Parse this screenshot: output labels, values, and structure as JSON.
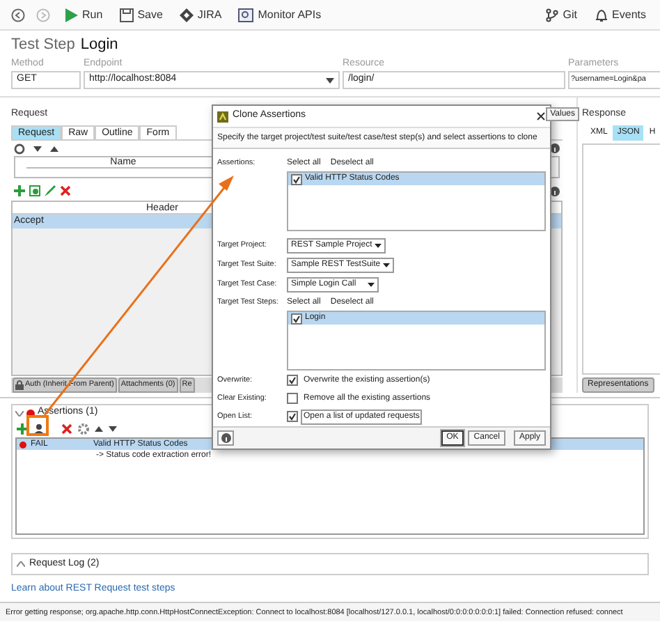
{
  "toolbar": {
    "items": [
      {
        "kind": "back"
      },
      {
        "kind": "forward"
      },
      {
        "kind": "run",
        "label": "Run"
      },
      {
        "kind": "save",
        "label": "Save"
      },
      {
        "kind": "jira",
        "label": "JIRA"
      },
      {
        "kind": "monitor",
        "label": "Monitor APIs"
      }
    ],
    "right_items": [
      {
        "kind": "git",
        "label": "Git"
      },
      {
        "kind": "events",
        "label": "Events"
      }
    ]
  },
  "header": {
    "prefix": "Test Step",
    "name": "Login"
  },
  "fields": [
    {
      "label": "Method",
      "value": "GET"
    },
    {
      "label": "Endpoint",
      "value": "http://localhost:8084",
      "dropdown": true
    },
    {
      "label": "Resource",
      "value": "/login/"
    },
    {
      "label": "Parameters",
      "value": "?username=Login&pa"
    }
  ],
  "request": {
    "title": "Request",
    "tabs": [
      {
        "label": "Request",
        "selected": true
      },
      {
        "label": "Raw",
        "selected": false
      },
      {
        "label": "Outline",
        "selected": false
      },
      {
        "label": "Form",
        "selected": false
      }
    ],
    "values_button": "Values",
    "params_column": "Name",
    "headers_column": "Header",
    "header_rows": [
      {
        "name": "Accept",
        "selected": true
      }
    ],
    "bottom_tabs": [
      {
        "label": "Auth (Inherit From Parent)",
        "kind": "lock"
      },
      {
        "label": "Attachments (0)"
      },
      {
        "label": "Re"
      }
    ]
  },
  "response": {
    "title": "Response",
    "tabs": [
      {
        "label": "XML",
        "selected": false
      },
      {
        "label": "JSON",
        "selected": true
      },
      {
        "label": "H",
        "selected": false
      }
    ],
    "bottom_button": "Representations"
  },
  "assertions": {
    "title": "Assertions (1)",
    "expanded": true,
    "rows": [
      {
        "status": "FAIL",
        "name": "Valid HTTP Status Codes",
        "detail": "-> Status code extraction error!",
        "selected": true
      }
    ]
  },
  "request_log": {
    "title": "Request Log (2)",
    "expanded": false
  },
  "link": "Learn about REST Request test steps",
  "status_bar": "Error getting response; org.apache.http.conn.HttpHostConnectException: Connect to localhost:8084 [localhost/127.0.0.1, localhost/0:0:0:0:0:0:0:1] failed: Connection refused: connect",
  "dialog": {
    "title": "Clone Assertions",
    "description": "Specify the target project/test suite/test case/test step(s) and select assertions to clone",
    "assertions_label": "Assertions:",
    "select_all": "Select all",
    "deselect_all": "Deselect all",
    "assertion_items": [
      {
        "label": "Valid HTTP Status Codes",
        "checked": true,
        "selected": true
      }
    ],
    "combos": [
      {
        "label": "Target Project:",
        "value": "REST Sample Project"
      },
      {
        "label": "Target Test Suite:",
        "value": "Sample REST TestSuite"
      },
      {
        "label": "Target Test Case:",
        "value": "Simple Login Call"
      }
    ],
    "steps_label": "Target Test Steps:",
    "steps_select_all": "Select all",
    "steps_deselect_all": "Deselect all",
    "step_items": [
      {
        "label": "Login",
        "checked": true,
        "selected": true
      }
    ],
    "options": [
      {
        "label": "Overwrite:",
        "text": "Overwrite the existing assertion(s)",
        "checked": true,
        "focused": false
      },
      {
        "label": "Clear Existing:",
        "text": "Remove all the existing assertions",
        "checked": false,
        "focused": false
      },
      {
        "label": "Open List:",
        "text": "Open a list of updated requests",
        "checked": true,
        "focused": true
      }
    ],
    "buttons": [
      {
        "label": "OK",
        "default": true
      },
      {
        "label": "Cancel",
        "default": false
      },
      {
        "label": "Apply",
        "default": false
      }
    ]
  }
}
